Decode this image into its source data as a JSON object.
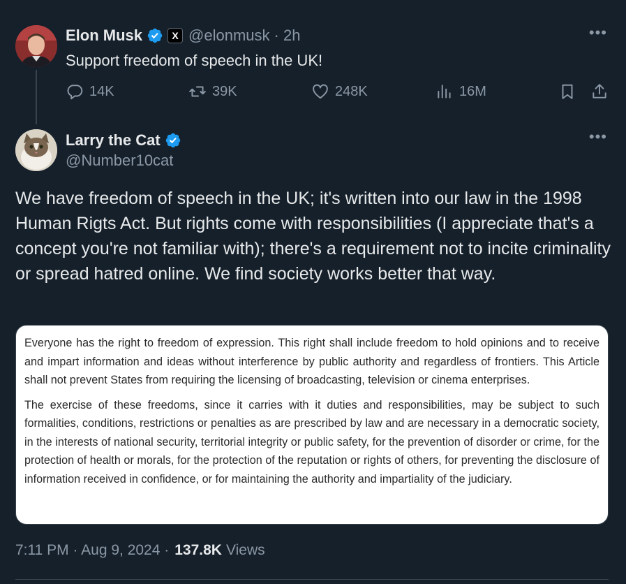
{
  "parent_tweet": {
    "name": "Elon Musk",
    "affiliate_badge": "X",
    "handle": "@elonmusk",
    "time": "· 2h",
    "text": "Support freedom of speech in the UK!",
    "stats": {
      "replies": "14K",
      "retweets": "39K",
      "likes": "248K",
      "views": "16M"
    },
    "more_label": "•••"
  },
  "main_tweet": {
    "name": "Larry the Cat",
    "handle": "@Number10cat",
    "text": "We have freedom of speech in the UK; it's written into our law in the 1998 Human Rigts Act. But rights come with responsibilities (I appreciate that's a concept you're not familiar with); there's a requirement not to incite criminality or spread hatred online. We find society works better that way.",
    "quoted_image": {
      "paragraph_1": "Everyone has the right to freedom of expression. This right shall include freedom to hold opinions and to receive and impart information and ideas without interference by public authority and regardless of frontiers. This Article shall not prevent States from requiring the licensing of broadcasting, television or cinema enterprises.",
      "paragraph_2": "The exercise of these freedoms, since it carries with it duties and responsibilities, may be subject to such formalities, conditions, restrictions or penalties as are prescribed by law and are necessary in a democratic society, in the interests of national security, territorial integrity or public safety, for the prevention of disorder or crime, for the protection of health or morals, for the protection of the reputation or rights of others, for preventing the disclosure of information received in confidence, or for maintaining the authority and impartiality of the judiciary."
    },
    "timestamp": "7:11 PM · Aug 9, 2024 ·",
    "views_count": "137.8K",
    "views_label": "Views",
    "more_label": "•••"
  },
  "icons": {
    "verified": "verified-badge-icon",
    "reply": "reply-icon",
    "retweet": "retweet-icon",
    "like": "heart-icon",
    "views": "views-chart-icon",
    "bookmark": "bookmark-icon",
    "share": "share-icon"
  },
  "colors": {
    "background": "#15202b",
    "text_primary": "#e7e9ea",
    "text_secondary": "#8b98a5",
    "verified_blue": "#1d9bf0",
    "divider": "#38444d"
  }
}
